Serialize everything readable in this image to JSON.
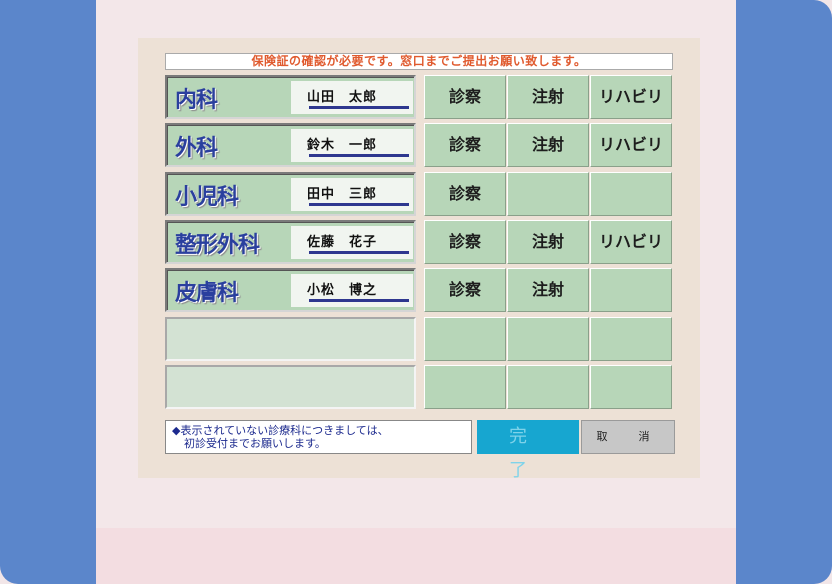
{
  "notice": "保険証の確認が必要です。窓口までご提出お願い致します。",
  "departments": [
    {
      "name": "内科",
      "doctor": "山田　太郎",
      "services": [
        "診察",
        "注射",
        "リハビリ"
      ]
    },
    {
      "name": "外科",
      "doctor": "鈴木　一郎",
      "services": [
        "診察",
        "注射",
        "リハビリ"
      ]
    },
    {
      "name": "小児科",
      "doctor": "田中　三郎",
      "services": [
        "診察",
        "",
        ""
      ]
    },
    {
      "name": "整形外科",
      "doctor": "佐藤　花子",
      "services": [
        "診察",
        "注射",
        "リハビリ"
      ]
    },
    {
      "name": "皮膚科",
      "doctor": "小松　博之",
      "services": [
        "診察",
        "注射",
        ""
      ]
    },
    {
      "name": "",
      "doctor": "",
      "services": [
        "",
        "",
        ""
      ]
    },
    {
      "name": "",
      "doctor": "",
      "services": [
        "",
        "",
        ""
      ]
    }
  ],
  "info": {
    "line1": "◆表示されていない診療科につきましては、",
    "line2": "初診受付までお願いします。"
  },
  "buttons": {
    "done": "完　了",
    "cancel": "取　消"
  },
  "colors": {
    "side": "#5b86cb",
    "cell_green": "#b7d6b8",
    "done_blue": "#17a6d0",
    "notice_text": "#e05a2e",
    "dept_text": "#2a3f9e"
  }
}
